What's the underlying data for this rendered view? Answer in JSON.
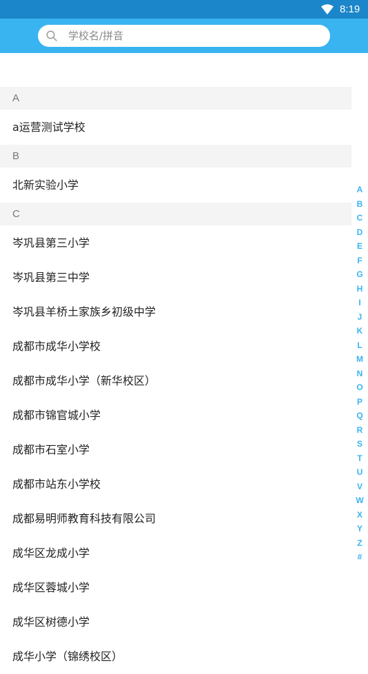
{
  "status_bar": {
    "time": "8:19"
  },
  "search": {
    "placeholder": "学校名/拼音",
    "value": ""
  },
  "sections": [
    {
      "letter": "A",
      "items": [
        "a运营测试学校"
      ]
    },
    {
      "letter": "B",
      "items": [
        "北新实验小学"
      ]
    },
    {
      "letter": "C",
      "items": [
        "岑巩县第三小学",
        "岑巩县第三中学",
        "岑巩县羊桥土家族乡初级中学",
        "成都市成华小学校",
        "成都市成华小学（新华校区）",
        "成都市锦官城小学",
        "成都市石室小学",
        "成都市站东小学校",
        "成都易明师教育科技有限公司",
        "成华区龙成小学",
        "成华区蓉城小学",
        "成华区树德小学",
        "成华小学（锦绣校区）"
      ]
    }
  ],
  "index_letters": [
    "A",
    "B",
    "C",
    "D",
    "E",
    "F",
    "G",
    "H",
    "I",
    "J",
    "K",
    "L",
    "M",
    "N",
    "O",
    "P",
    "Q",
    "R",
    "S",
    "T",
    "U",
    "V",
    "W",
    "X",
    "Y",
    "Z",
    "#"
  ],
  "colors": {
    "status_bar": "#1b86c9",
    "header": "#39b4f1",
    "index": "#39b4f1"
  },
  "icons": {
    "wifi": "wifi-icon",
    "search": "search-icon"
  }
}
